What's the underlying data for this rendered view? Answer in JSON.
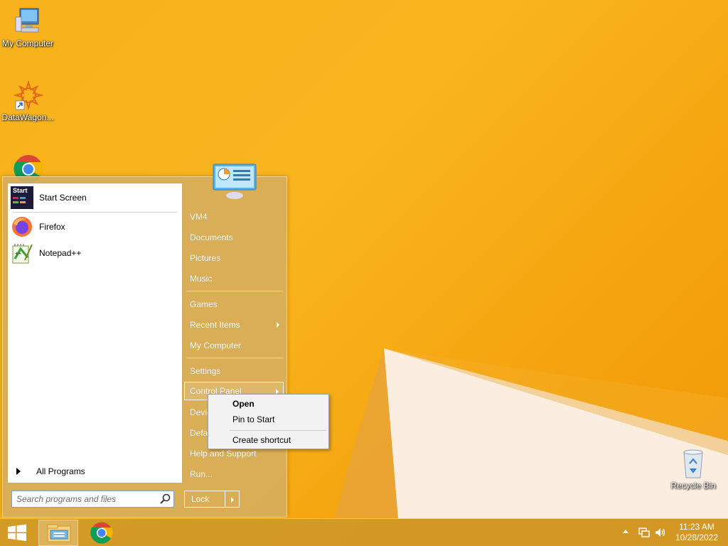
{
  "desktop": {
    "icons": [
      {
        "label": "My Computer",
        "icon": "computer-icon"
      },
      {
        "label": "DataWagon...",
        "icon": "datawagon-icon"
      },
      {
        "label": "Google Chrome",
        "icon": "chrome-icon"
      },
      {
        "label": "Recycle Bin",
        "icon": "recycle-bin-icon"
      }
    ]
  },
  "start_menu": {
    "pinned": [
      {
        "label": "Start Screen",
        "icon": "start-screen-icon"
      },
      {
        "label": "Firefox",
        "icon": "firefox-icon"
      },
      {
        "label": "Notepad++",
        "icon": "notepadpp-icon"
      }
    ],
    "start_screen_tile_text": "Start",
    "all_programs": "All Programs",
    "search_placeholder": "Search programs and files",
    "right_items": [
      {
        "label": "VM4"
      },
      {
        "label": "Documents"
      },
      {
        "label": "Pictures"
      },
      {
        "label": "Music"
      },
      {
        "label": "Games"
      },
      {
        "label": "Recent Items",
        "submenu": true
      },
      {
        "label": "My Computer"
      },
      {
        "label": "Settings"
      },
      {
        "label": "Control Panel",
        "submenu": true,
        "active": true
      },
      {
        "label": "Devices and Printers"
      },
      {
        "label": "Default Programs"
      },
      {
        "label": "Help and Support"
      },
      {
        "label": "Run..."
      }
    ],
    "lock_label": "Lock"
  },
  "context_menu": {
    "items": [
      {
        "label": "Open",
        "bold": true
      },
      {
        "label": "Pin to Start"
      },
      {
        "label": "Create shortcut"
      }
    ]
  },
  "taskbar": {
    "apps": [
      {
        "name": "File Explorer",
        "icon": "file-explorer-icon",
        "active": true
      },
      {
        "name": "Google Chrome",
        "icon": "chrome-icon"
      }
    ],
    "time": "11:23 AM",
    "date": "10/28/2022"
  },
  "colors": {
    "desktop_bg": "#f7b21c",
    "start_menu_bg": "#d6ae5c",
    "taskbar_bg": "#ce9628"
  }
}
